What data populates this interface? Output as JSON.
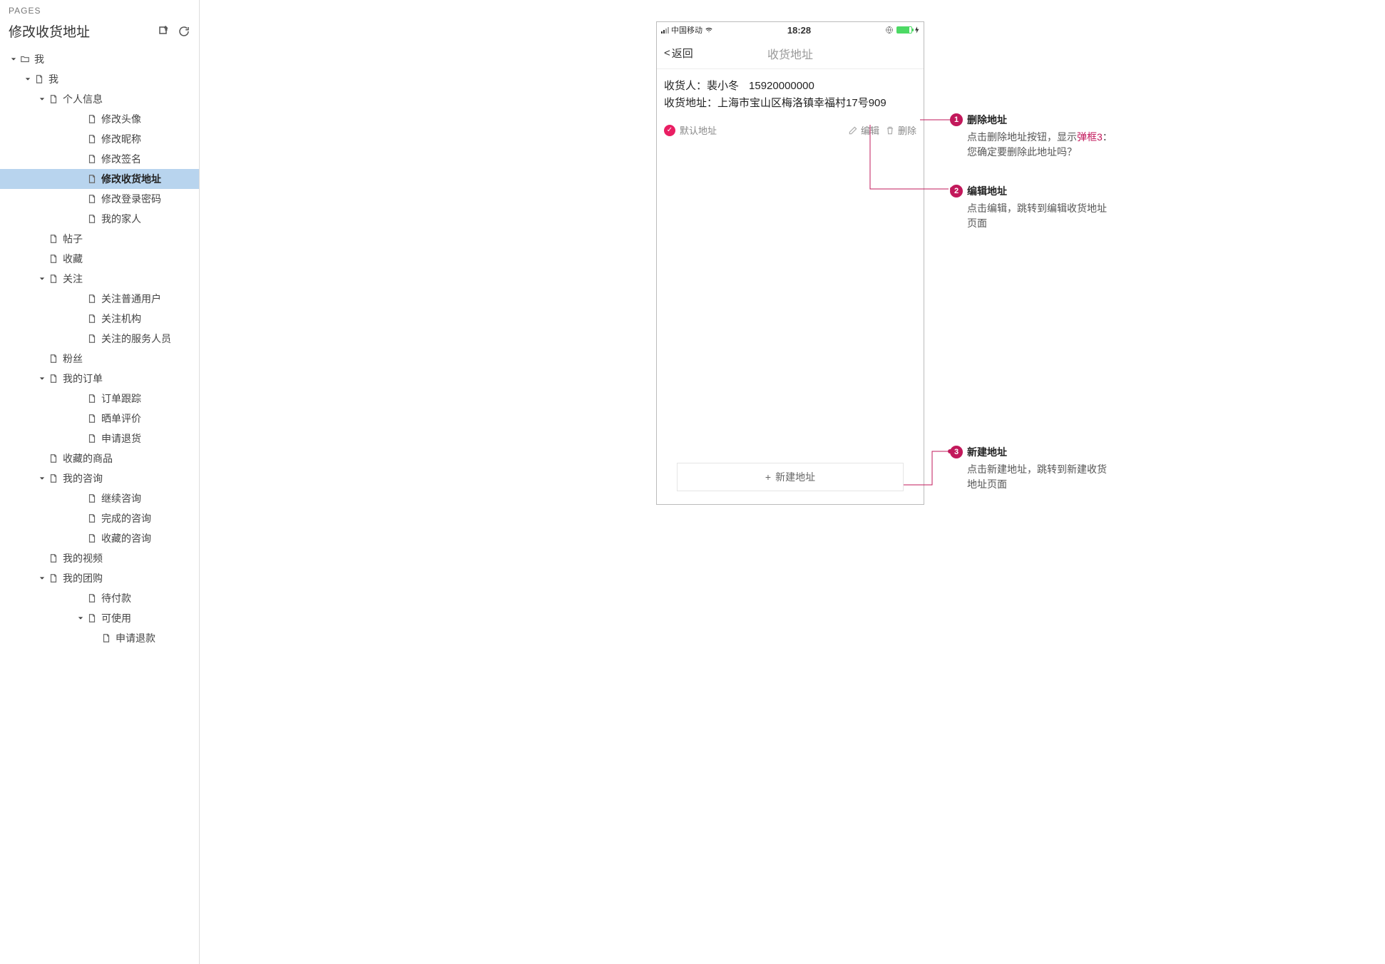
{
  "sidebar": {
    "header_label": "PAGES",
    "title": "修改收货地址",
    "tree": [
      {
        "depth": 0,
        "expandable": true,
        "expanded": true,
        "icon": "folder",
        "label": "我"
      },
      {
        "depth": 1,
        "expandable": true,
        "expanded": true,
        "icon": "page",
        "label": "我"
      },
      {
        "depth": 2,
        "expandable": true,
        "expanded": true,
        "icon": "page",
        "label": "个人信息"
      },
      {
        "depth": 3,
        "expandable": false,
        "icon": "page",
        "label": "修改头像"
      },
      {
        "depth": 3,
        "expandable": false,
        "icon": "page",
        "label": "修改昵称"
      },
      {
        "depth": 3,
        "expandable": false,
        "icon": "page",
        "label": "修改签名"
      },
      {
        "depth": 3,
        "expandable": false,
        "icon": "page",
        "label": "修改收货地址",
        "selected": true
      },
      {
        "depth": 3,
        "expandable": false,
        "icon": "page",
        "label": "修改登录密码"
      },
      {
        "depth": 3,
        "expandable": false,
        "icon": "page",
        "label": "我的家人"
      },
      {
        "depth": 2,
        "expandable": false,
        "icon": "page",
        "label": "帖子"
      },
      {
        "depth": 2,
        "expandable": false,
        "icon": "page",
        "label": "收藏"
      },
      {
        "depth": 2,
        "expandable": true,
        "expanded": true,
        "icon": "page",
        "label": "关注"
      },
      {
        "depth": 3,
        "expandable": false,
        "icon": "page",
        "label": "关注普通用户"
      },
      {
        "depth": 3,
        "expandable": false,
        "icon": "page",
        "label": "关注机构"
      },
      {
        "depth": 3,
        "expandable": false,
        "icon": "page",
        "label": "关注的服务人员"
      },
      {
        "depth": 2,
        "expandable": false,
        "icon": "page",
        "label": "粉丝"
      },
      {
        "depth": 2,
        "expandable": true,
        "expanded": true,
        "icon": "page",
        "label": "我的订单"
      },
      {
        "depth": 3,
        "expandable": false,
        "icon": "page",
        "label": "订单跟踪"
      },
      {
        "depth": 3,
        "expandable": false,
        "icon": "page",
        "label": "晒单评价"
      },
      {
        "depth": 3,
        "expandable": false,
        "icon": "page",
        "label": "申请退货"
      },
      {
        "depth": 2,
        "expandable": false,
        "icon": "page",
        "label": "收藏的商品"
      },
      {
        "depth": 2,
        "expandable": true,
        "expanded": true,
        "icon": "page",
        "label": "我的咨询"
      },
      {
        "depth": 3,
        "expandable": false,
        "icon": "page",
        "label": "继续咨询"
      },
      {
        "depth": 3,
        "expandable": false,
        "icon": "page",
        "label": "完成的咨询"
      },
      {
        "depth": 3,
        "expandable": false,
        "icon": "page",
        "label": "收藏的咨询"
      },
      {
        "depth": 2,
        "expandable": false,
        "icon": "page",
        "label": "我的视频"
      },
      {
        "depth": 2,
        "expandable": true,
        "expanded": true,
        "icon": "page",
        "label": "我的团购"
      },
      {
        "depth": 3,
        "expandable": false,
        "icon": "page",
        "label": "待付款"
      },
      {
        "depth": 3,
        "expandable": true,
        "expanded": true,
        "icon": "page",
        "label": "可使用"
      },
      {
        "depth": 4,
        "expandable": false,
        "icon": "page",
        "label": "申请退款"
      }
    ]
  },
  "phone": {
    "status": {
      "carrier": "中国移动",
      "time": "18:28"
    },
    "nav": {
      "back": "返回",
      "title": "收货地址"
    },
    "card": {
      "recipient_label": "收货人：",
      "recipient_name": "裴小冬",
      "recipient_phone": "15920000000",
      "address_label": "收货地址：",
      "address_value": "上海市宝山区梅洛镇幸福村17号909"
    },
    "actions": {
      "default_label": "默认地址",
      "edit_label": "编辑",
      "delete_label": "删除"
    },
    "new_btn": {
      "plus": "+",
      "label": "新建地址"
    }
  },
  "annotations": [
    {
      "num": "1",
      "title": "删除地址",
      "body_pre": "点击删除地址按钮，显示",
      "link": "弹框3",
      "body_post": "：您确定要删除此地址吗？"
    },
    {
      "num": "2",
      "title": "编辑地址",
      "body": "点击编辑，跳转到编辑收货地址页面"
    },
    {
      "num": "3",
      "title": "新建地址",
      "body": "点击新建地址，跳转到新建收货地址页面"
    }
  ]
}
